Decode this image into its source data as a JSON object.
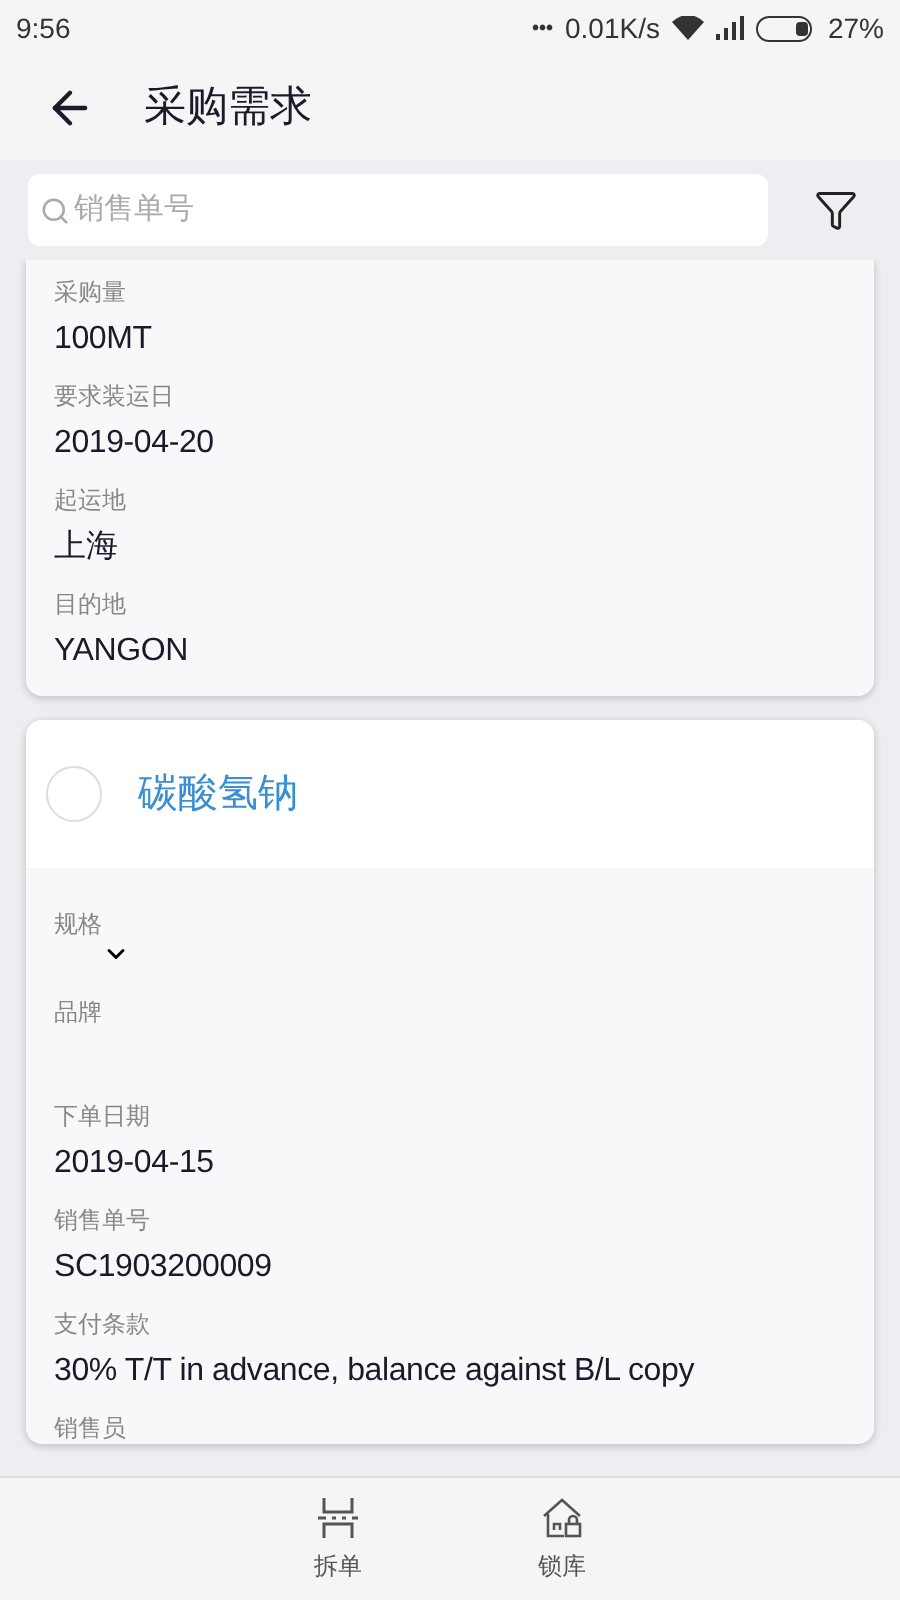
{
  "status_bar": {
    "time": "9:56",
    "dots": "•••",
    "speed": "0.01K/s",
    "battery": "27%"
  },
  "header": {
    "title": "采购需求"
  },
  "search": {
    "placeholder": "销售单号"
  },
  "cards": [
    {
      "fields": [
        {
          "kind": "text",
          "label": "采购量",
          "value": "100MT"
        },
        {
          "kind": "text",
          "label": "要求装运日",
          "value": "2019-04-20"
        },
        {
          "kind": "text",
          "label": "起运地",
          "value": "上海"
        },
        {
          "kind": "text",
          "label": "目的地",
          "value": "YANGON"
        }
      ]
    },
    {
      "title": "碳酸氢钠",
      "selected": false,
      "fields": [
        {
          "kind": "expand",
          "label": "规格",
          "expanded": false
        },
        {
          "kind": "empty",
          "label": "品牌"
        },
        {
          "kind": "text",
          "label": "下单日期",
          "value": "2019-04-15"
        },
        {
          "kind": "text",
          "label": "销售单号",
          "value": "SC1903200009"
        },
        {
          "kind": "text",
          "label": "支付条款",
          "value": "30% T/T in advance, balance against B/L copy"
        },
        {
          "kind": "label",
          "label": "销售员"
        }
      ]
    }
  ],
  "bottom_actions": [
    {
      "kind": "split",
      "label": "拆单"
    },
    {
      "kind": "lock",
      "label": "锁库"
    }
  ]
}
